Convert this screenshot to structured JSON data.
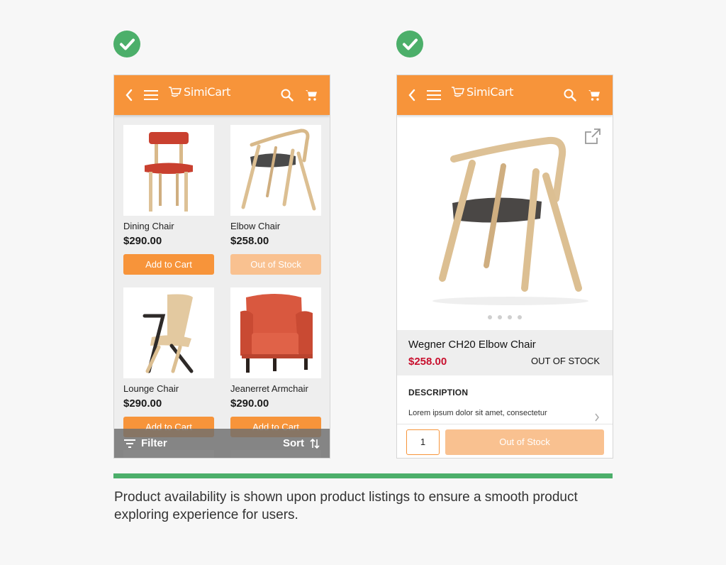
{
  "colors": {
    "brand_orange": "#f7943a",
    "disabled_orange": "#f9c190",
    "check_green": "#4caf6a",
    "price_red": "#c8102e"
  },
  "app": {
    "logo_text": "SimiCart"
  },
  "list_screen": {
    "products": [
      {
        "name": "Dining Chair",
        "price": "$290.00",
        "button": "Add to Cart",
        "in_stock": true
      },
      {
        "name": "Elbow Chair",
        "price": "$258.00",
        "button": "Out of Stock",
        "in_stock": false
      },
      {
        "name": "Lounge Chair",
        "price": "$290.00",
        "button": "Add to Cart",
        "in_stock": true
      },
      {
        "name": "Jeanerret Armchair",
        "price": "$290.00",
        "button": "Add to Cart",
        "in_stock": true
      }
    ],
    "filter_label": "Filter",
    "sort_label": "Sort"
  },
  "detail_screen": {
    "product_name": "Wegner CH20 Elbow Chair",
    "price": "$258.00",
    "stock_status": "OUT OF STOCK",
    "description_title": "DESCRIPTION",
    "description_text": "Lorem ipsum dolor sit amet, consectetur",
    "quantity": "1",
    "action_button": "Out of Stock",
    "image_dots": 4
  },
  "caption": "Product availability is shown upon product listings to ensure a smooth product exploring experience for users."
}
